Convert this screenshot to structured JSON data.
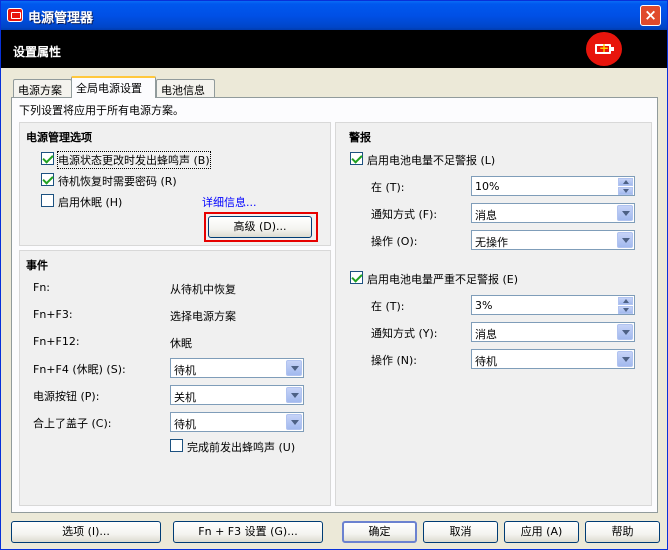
{
  "window": {
    "title": "电源管理器",
    "close_icon": "close-icon"
  },
  "banner": {
    "title": "设置属性"
  },
  "tabs": [
    {
      "label": "电源方案"
    },
    {
      "label": "全局电源设置"
    },
    {
      "label": "电池信息"
    }
  ],
  "panel": {
    "description": "下列设置将应用于所有电源方案。"
  },
  "power_options": {
    "title": "电源管理选项",
    "beep_on_change": {
      "label": "电源状态更改时发出蜂鸣声 (B)",
      "checked": true
    },
    "password_on_resume": {
      "label": "待机恢复时需要密码 (R)",
      "checked": true
    },
    "hibernate": {
      "label": "启用休眠 (H)",
      "checked": false
    },
    "details_link": "详细信息...",
    "advanced_button": "高级 (D)..."
  },
  "events": {
    "title": "事件",
    "rows": [
      {
        "key": "Fn:",
        "value": "从待机中恢复"
      },
      {
        "key": "Fn+F3:",
        "value": "选择电源方案"
      },
      {
        "key": "Fn+F12:",
        "value": "休眠"
      }
    ],
    "fn_f4": {
      "label": "Fn+F4 (休眠) (S):",
      "value": "待机"
    },
    "power_button": {
      "label": "电源按钮 (P):",
      "value": "关机"
    },
    "lid_close": {
      "label": "合上了盖子 (C):",
      "value": "待机"
    },
    "beep_before_done": {
      "label": "完成前发出蜂鸣声 (U)",
      "checked": false
    }
  },
  "alarms": {
    "title": "警报",
    "low": {
      "enable": {
        "label": "启用电池电量不足警报 (L)",
        "checked": true
      },
      "at_label": "在 (T):",
      "at_value": "10%",
      "notify_label": "通知方式 (F):",
      "notify_value": "消息",
      "action_label": "操作 (O):",
      "action_value": "无操作"
    },
    "critical": {
      "enable": {
        "label": "启用电池电量严重不足警报 (E)",
        "checked": true
      },
      "at_label": "在 (T):",
      "at_value": "3%",
      "notify_label": "通知方式 (Y):",
      "notify_value": "消息",
      "action_label": "操作 (N):",
      "action_value": "待机"
    }
  },
  "footer": {
    "options": "选项 (I)...",
    "fn_f3_settings": "Fn + F3 设置 (G)...",
    "ok": "确定",
    "cancel": "取消",
    "apply": "应用 (A)",
    "help": "帮助"
  },
  "colors": {
    "titlebar": "#0054e3",
    "highlight_box": "#e60000",
    "accent_red": "#e8150c"
  }
}
